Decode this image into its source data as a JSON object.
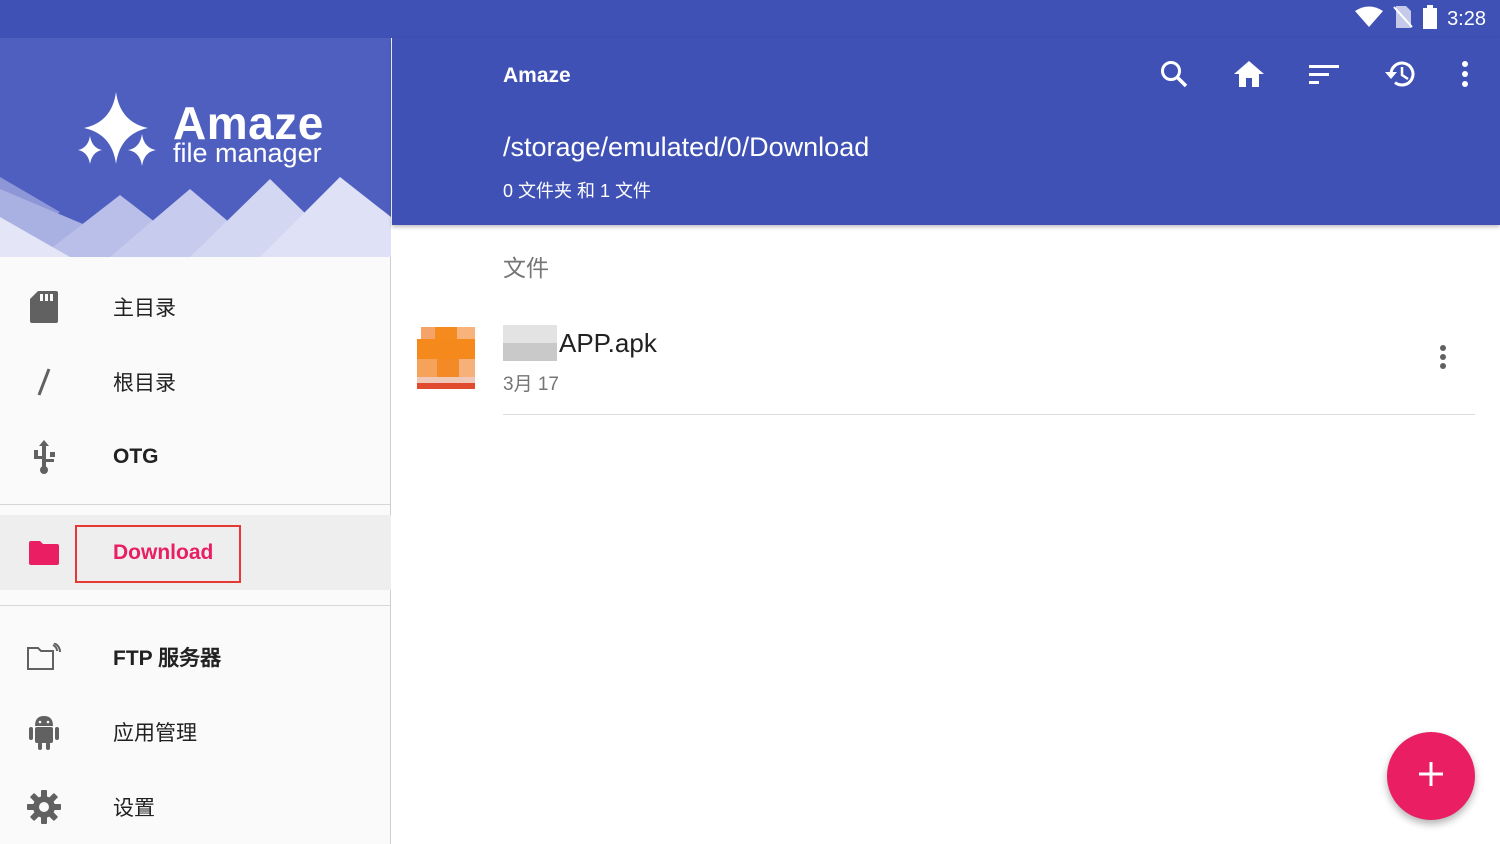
{
  "status_bar": {
    "time": "3:28"
  },
  "drawer": {
    "logo_title": "Amaze",
    "logo_subtitle": "file manager",
    "items": [
      {
        "label": "主目录",
        "icon": "sd-card-icon"
      },
      {
        "label": "根目录",
        "icon": "slash-icon"
      },
      {
        "label": "OTG",
        "icon": "usb-icon"
      },
      {
        "label": "Download",
        "icon": "folder-icon",
        "selected": true
      },
      {
        "label": "FTP 服务器",
        "icon": "ftp-folder-icon"
      },
      {
        "label": "应用管理",
        "icon": "android-icon"
      },
      {
        "label": "设置",
        "icon": "gear-icon"
      }
    ]
  },
  "app_bar": {
    "title": "Amaze",
    "path": "/storage/emulated/0/Download",
    "summary": "0 文件夹 和 1 文件",
    "actions": [
      "search-icon",
      "home-icon",
      "sort-icon",
      "history-icon",
      "more-vert-icon"
    ]
  },
  "content": {
    "section_header": "文件",
    "files": [
      {
        "name": "APP.apk",
        "date": "3月 17"
      }
    ]
  },
  "colors": {
    "primary": "#3F51B5",
    "accent": "#E91E63",
    "highlight_box": "#E53935"
  }
}
